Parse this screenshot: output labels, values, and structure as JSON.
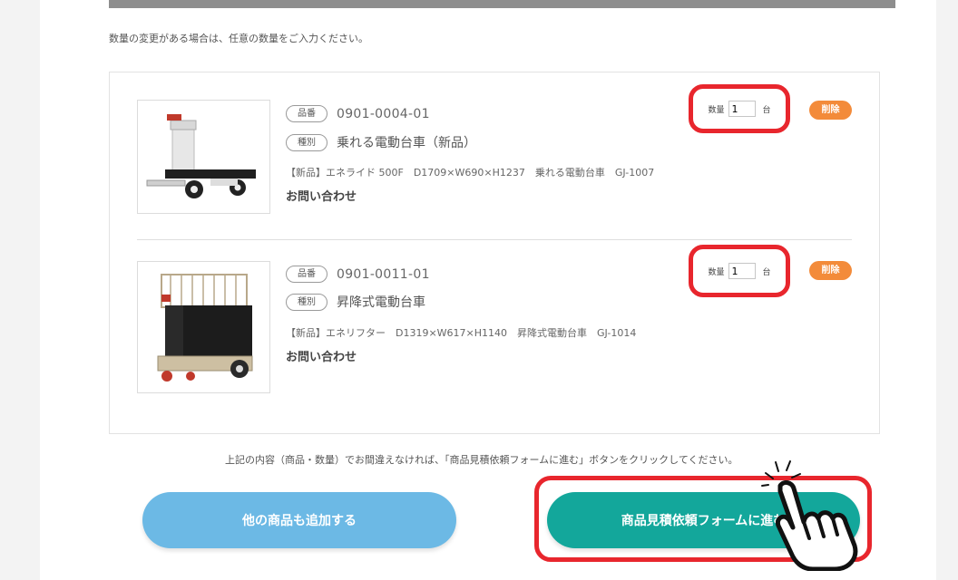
{
  "colors": {
    "highlight_red": "#e8262d",
    "delete_orange": "#f38b3a",
    "add_blue": "#6cb9e5",
    "form_teal": "#13a79b"
  },
  "note": "数量の変更がある場合は、任意の数量をご入力ください。",
  "items": [
    {
      "part_label": "品番",
      "part_number": "0901-0004-01",
      "type_label": "種別",
      "type": "乗れる電動台車（新品）",
      "description": "【新品】エネライド 500F　D1709×W690×H1237　乗れる電動台車　GJ-1007",
      "price": "お問い合わせ",
      "qty_label": "数量",
      "qty": "1",
      "qty_unit": "台",
      "delete_label": "削除"
    },
    {
      "part_label": "品番",
      "part_number": "0901-0011-01",
      "type_label": "種別",
      "type": "昇降式電動台車",
      "description": "【新品】エネリフター　D1319×W617×H1140　昇降式電動台車　GJ-1014",
      "price": "お問い合わせ",
      "qty_label": "数量",
      "qty": "1",
      "qty_unit": "台",
      "delete_label": "削除"
    }
  ],
  "confirm_text": "上記の内容（商品・数量）でお間違えなければ、「商品見積依頼フォームに進む」ボタンをクリックしてください。",
  "buttons": {
    "add_more": "他の商品も追加する",
    "proceed": "商品見積依頼フォームに進む"
  },
  "icons": {
    "pointer": "pointing-hand-icon"
  }
}
